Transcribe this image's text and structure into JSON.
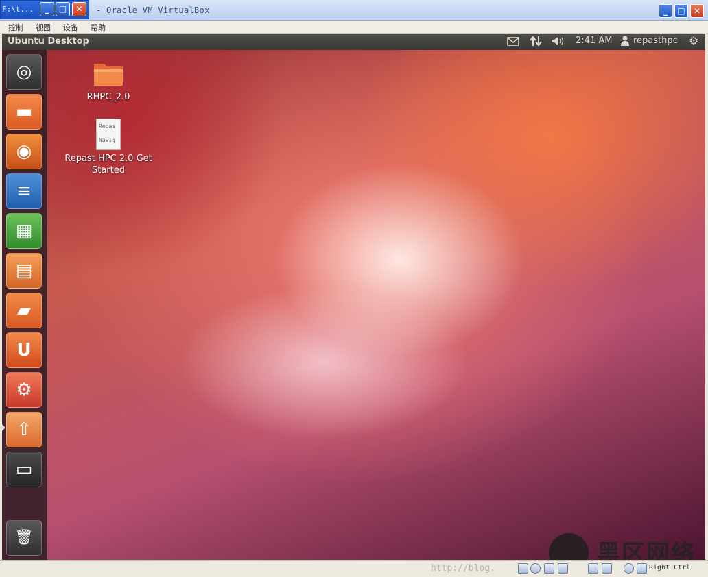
{
  "host_window": {
    "title": "] - Oracle VM VirtualBox",
    "overlay_title": "F:\\t...",
    "minimize_glyph": "_",
    "maximize_glyph": "□",
    "close_glyph": "✕"
  },
  "menubar": {
    "items": [
      {
        "label": "控制"
      },
      {
        "label": "视图"
      },
      {
        "label": "设备"
      },
      {
        "label": "帮助"
      }
    ]
  },
  "guest": {
    "panel": {
      "title": "Ubuntu Desktop",
      "time": "2:41 AM",
      "user": "repasthpc",
      "indicators": [
        "mail-icon",
        "network-icon",
        "volume-icon",
        "user-icon",
        "session-gear-icon"
      ]
    },
    "launcher": {
      "items": [
        {
          "name": "dash-home",
          "glyph": "◎"
        },
        {
          "name": "home-folder",
          "glyph": "▬"
        },
        {
          "name": "firefox",
          "glyph": "◉"
        },
        {
          "name": "libreoffice-writer",
          "glyph": "≡"
        },
        {
          "name": "libreoffice-calc",
          "glyph": "▦"
        },
        {
          "name": "libreoffice-impress",
          "glyph": "▤"
        },
        {
          "name": "ubuntu-software-center",
          "glyph": "▰"
        },
        {
          "name": "ubuntu-one",
          "glyph": "U"
        },
        {
          "name": "system-settings",
          "glyph": "⚙"
        },
        {
          "name": "update-manager",
          "glyph": "⇧"
        },
        {
          "name": "workspace-switcher",
          "glyph": "▭"
        },
        {
          "name": "trash",
          "glyph": "🗑"
        }
      ]
    },
    "desktop_icons": [
      {
        "label": "RHPC_2.0",
        "type": "folder"
      },
      {
        "label": "Repast HPC 2.0 Get Started",
        "type": "document",
        "preview_lines": [
          "Repas",
          "Navig"
        ]
      }
    ]
  },
  "statusbar": {
    "watermark": "http://blog.",
    "host_key": "Right Ctrl",
    "brand_text": "黑区网络"
  },
  "colors": {
    "panel": "#3f3e39",
    "launcher": "#321c24",
    "wallpaper_accent": "#e8674a",
    "xp_blue": "#2e6be0"
  }
}
